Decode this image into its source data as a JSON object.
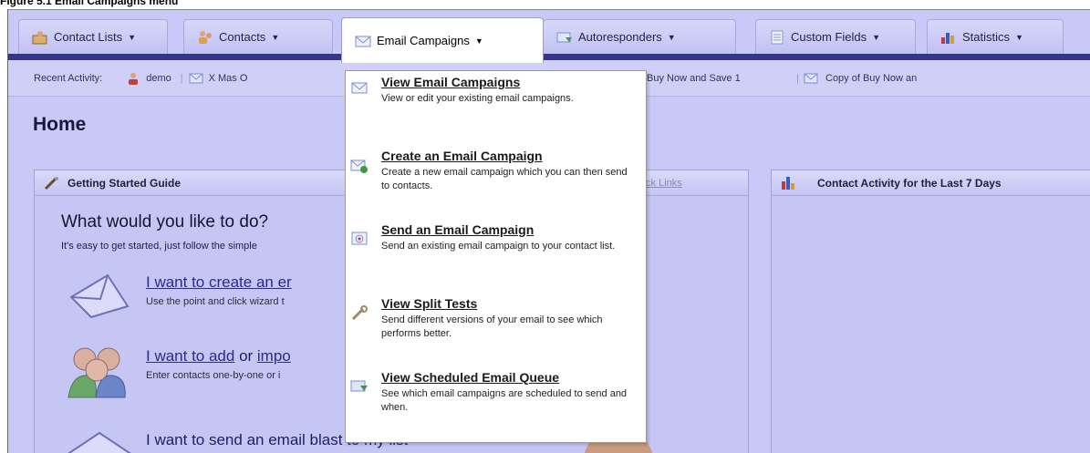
{
  "caption": "Figure 5.1 Email Campaigns menu",
  "tabs": [
    {
      "label": "Contact Lists",
      "icon": "contact-lists-icon"
    },
    {
      "label": "Contacts",
      "icon": "contacts-icon"
    },
    {
      "label": "Email Campaigns",
      "icon": "envelope-icon"
    },
    {
      "label": "Autoresponders",
      "icon": "autoresponder-icon"
    },
    {
      "label": "Custom Fields",
      "icon": "custom-fields-icon"
    },
    {
      "label": "Statistics",
      "icon": "statistics-icon"
    }
  ],
  "recent": {
    "label": "Recent Activity:",
    "items": [
      "demo",
      "X Mas O",
      "Buy Now and Save 1",
      "Copy of Buy Now an"
    ]
  },
  "home_title": "Home",
  "getting_started": {
    "title": "Getting Started Guide",
    "switch_link": "ch to Quick Links",
    "question": "What would you like to do?",
    "intro": "It's easy to get started, just follow the simple",
    "tasks": [
      {
        "title": "I want to create an er",
        "desc": "Use the point and click wizard t"
      },
      {
        "title_a": "I want to add",
        "title_b": " or ",
        "title_c": "impo",
        "desc": "Enter contacts one-by-one or i"
      },
      {
        "title": "I want to send an email blast to my list"
      }
    ]
  },
  "contact_activity": {
    "title": "Contact Activity for the Last 7 Days"
  },
  "menu": {
    "items": [
      {
        "title": "View Email Campaigns",
        "desc": "View or edit your existing email campaigns.",
        "icon": "envelope-icon"
      },
      {
        "title": "Create an Email Campaign",
        "desc": "Create a new email campaign which you can then send to contacts.",
        "icon": "envelope-add-icon"
      },
      {
        "title": "Send an Email Campaign",
        "desc": "Send an existing email campaign to your contact list.",
        "icon": "send-envelope-icon"
      },
      {
        "title": "View Split Tests",
        "desc": "Send different versions of your email to see which performs better.",
        "icon": "wrench-icon"
      },
      {
        "title": "View Scheduled Email Queue",
        "desc": "See which email campaigns are scheduled to send and when.",
        "icon": "scheduled-envelope-icon"
      }
    ]
  },
  "colors": {
    "nav_bar": "#35358f",
    "overlay": "#c9c9f7",
    "menu_bg": "#ffffff"
  }
}
